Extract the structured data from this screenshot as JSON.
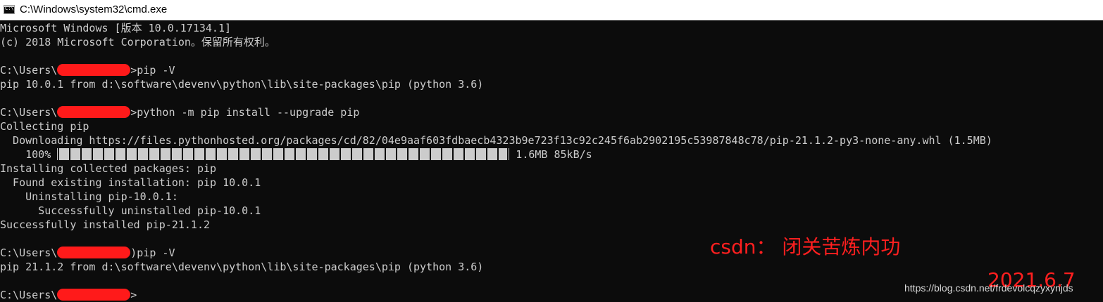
{
  "window": {
    "title": "C:\\Windows\\system32\\cmd.exe",
    "icon_label": "C:\\."
  },
  "colors": {
    "console_bg": "#0c0c0c",
    "console_text": "#cccccc",
    "annotation": "#ff1f1f"
  },
  "console": {
    "header1": "Microsoft Windows [版本 10.0.17134.1]",
    "header2": "(c) 2018 Microsoft Corporation。保留所有权利。",
    "prompt_prefix": "C:\\Users\\",
    "cmd1": ">pip -V",
    "out1": "pip 10.0.1 from d:\\software\\devenv\\python\\lib\\site-packages\\pip (python 3.6)",
    "cmd2": ">python -m pip install --upgrade pip",
    "collecting": "Collecting pip",
    "downloading": "  Downloading https://files.pythonhosted.org/packages/cd/82/04e9aaf603fdbaecb4323b9e723f13c92c245f6ab2902195c53987848c78/pip-21.1.2-py3-none-any.whl (1.5MB)",
    "progress_pct": "    100% ",
    "progress_fraction": 1.0,
    "progress_stats": " 1.6MB 85kB/s",
    "installing": "Installing collected packages: pip",
    "found": "  Found existing installation: pip 10.0.1",
    "uninstalling": "    Uninstalling pip-10.0.1:",
    "uninstalled": "      Successfully uninstalled pip-10.0.1",
    "installed": "Successfully installed pip-21.1.2",
    "cmd3": ")pip -V",
    "out3": "pip 21.1.2 from d:\\software\\devenv\\python\\lib\\site-packages\\pip (python 3.6)",
    "final_prompt_suffix": ">"
  },
  "annotations": {
    "csdn": "csdn：  闭关苦炼内功",
    "date": "2021.6.7",
    "watermark": "https://blog.csdn.net/frdevolcqzyxynjds"
  }
}
